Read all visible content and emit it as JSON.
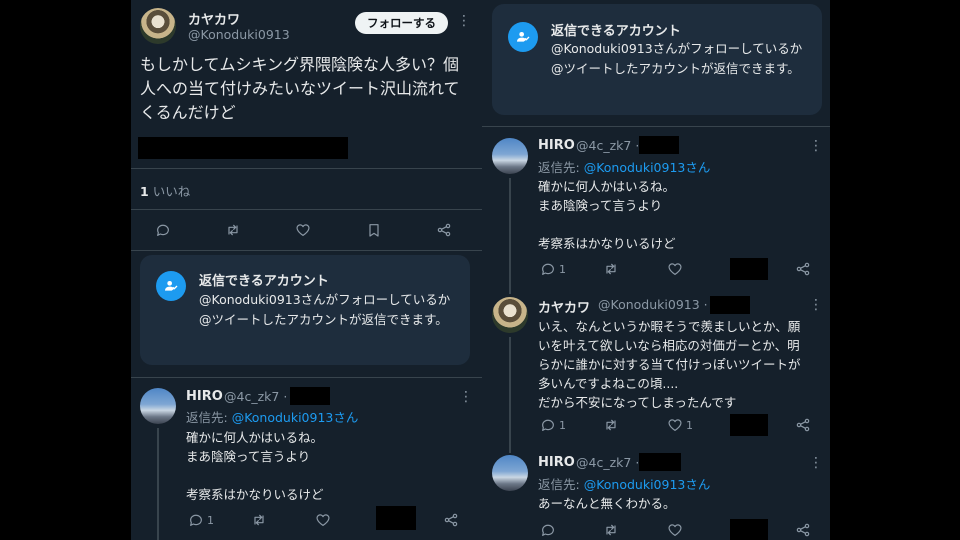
{
  "left": {
    "main_tweet": {
      "name": "カヤカワ",
      "handle": "@Konoduki0913",
      "follow_label": "フォローする",
      "text": "もしかしてムシキング界隈陰険な人多い？個人への当て付けみたいなツイート沢山流れてくるんだけど",
      "likes_count": "1",
      "likes_label": "いいね",
      "avatar_icon": "user-avatar"
    },
    "reply_card": {
      "title": "返信できるアカウント",
      "text": "@Konoduki0913さんがフォローしているか@ツイートしたアカウントが返信できます。",
      "icon": "people-icon"
    },
    "reply": {
      "name": "HIRO",
      "handle": "@4c_zk7",
      "sep": "·",
      "reply_prefix": "返信先: ",
      "reply_link": "@Konoduki0913さん",
      "text": "確かに何人かはいるね。\nまあ陰険って言うより\n\n考察系はかなりいるけど",
      "reply_count": "1"
    }
  },
  "right": {
    "reply_card": {
      "title": "返信できるアカウント",
      "text": "@Konoduki0913さんがフォローしているか@ツイートしたアカウントが返信できます。"
    },
    "tweets": [
      {
        "name": "HIRO",
        "handle": "@4c_zk7",
        "sep": "·",
        "reply_prefix": "返信先: ",
        "reply_link": "@Konoduki0913さん",
        "text": "確かに何人かはいるね。\nまあ陰険って言うより\n\n考察系はかなりいるけど",
        "reply_count": "1"
      },
      {
        "name": "カヤカワ",
        "handle": "@Konoduki0913",
        "sep": "·",
        "text": "いえ、なんというか暇そうで羨ましいとか、願いを叶えて欲しいなら相応の対価ガーとか、明らかに誰かに対する当て付けっぽいツイートが多いんですよねこの頃....\nだから不安になってしまったんです",
        "reply_count": "1",
        "like_count": "1"
      },
      {
        "name": "HIRO",
        "handle": "@4c_zk7",
        "sep": "·",
        "reply_prefix": "返信先: ",
        "reply_link": "@Konoduki0913さん",
        "text": "あーなんと無くわかる。"
      }
    ]
  },
  "colors": {
    "background": "#15202b",
    "card": "#1e2d3d",
    "accent": "#1d9bf0",
    "muted": "#8b98a5",
    "text": "#e7e9ea"
  }
}
